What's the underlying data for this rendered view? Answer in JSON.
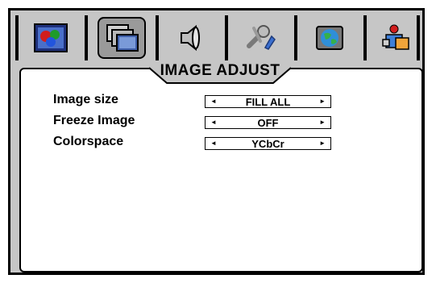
{
  "menu": {
    "title": "IMAGE ADJUST",
    "tabs": [
      {
        "icon": "picture-icon",
        "selected": false
      },
      {
        "icon": "image-adjust-icon",
        "selected": true
      },
      {
        "icon": "audio-icon",
        "selected": false
      },
      {
        "icon": "tools-icon",
        "selected": false
      },
      {
        "icon": "globe-icon",
        "selected": false
      },
      {
        "icon": "settings-icon",
        "selected": false
      }
    ]
  },
  "settings": [
    {
      "label": "Image size",
      "value": "FILL ALL"
    },
    {
      "label": "Freeze Image",
      "value": "OFF"
    },
    {
      "label": "Colorspace",
      "value": "YCbCr"
    }
  ],
  "arrows": {
    "left": "◄",
    "right": "►"
  },
  "colors": {
    "frame": "#c6c6c6",
    "selected_tab": "#9a9a9a",
    "panel": "#ffffff"
  }
}
